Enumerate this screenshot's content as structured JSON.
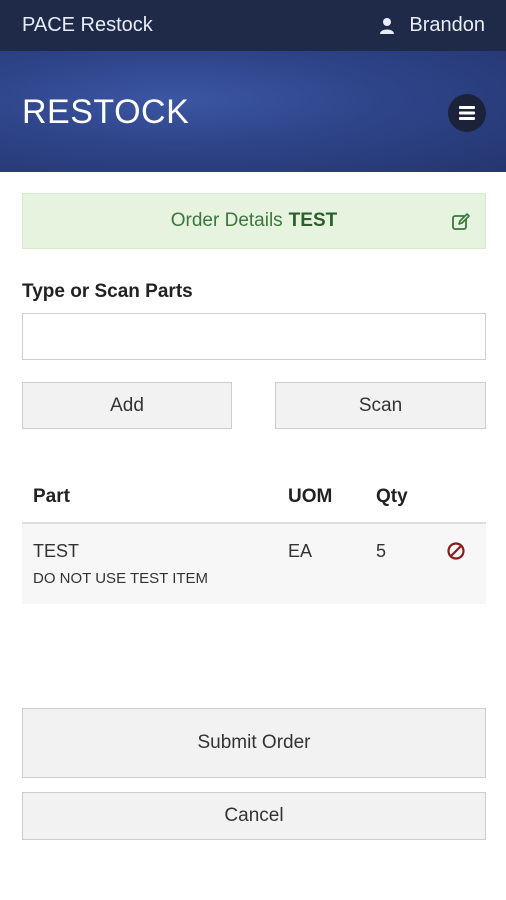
{
  "topbar": {
    "app_title": "PACE Restock",
    "user_icon": "user-icon",
    "user_name": "Brandon"
  },
  "banner": {
    "title": "RESTOCK",
    "menu_icon": "hamburger-menu-icon"
  },
  "order_alert": {
    "label": "Order Details",
    "order_name": "TEST",
    "edit_icon": "edit-icon",
    "text_color": "#3c763d",
    "bg_color": "#e6f4df"
  },
  "parts_form": {
    "label": "Type or Scan Parts",
    "input_value": "",
    "add_label": "Add",
    "scan_label": "Scan"
  },
  "parts_table": {
    "headers": {
      "part": "Part",
      "uom": "UOM",
      "qty": "Qty"
    },
    "rows": [
      {
        "part": "TEST",
        "description": "DO NOT USE TEST ITEM",
        "uom": "EA",
        "qty": "5",
        "remove_icon": "remove-circle-icon"
      }
    ]
  },
  "actions": {
    "submit_label": "Submit Order",
    "cancel_label": "Cancel"
  },
  "colors": {
    "topbar": "#1f2a48",
    "banner": "#2e4489",
    "remove_icon": "#8b1a1a"
  }
}
